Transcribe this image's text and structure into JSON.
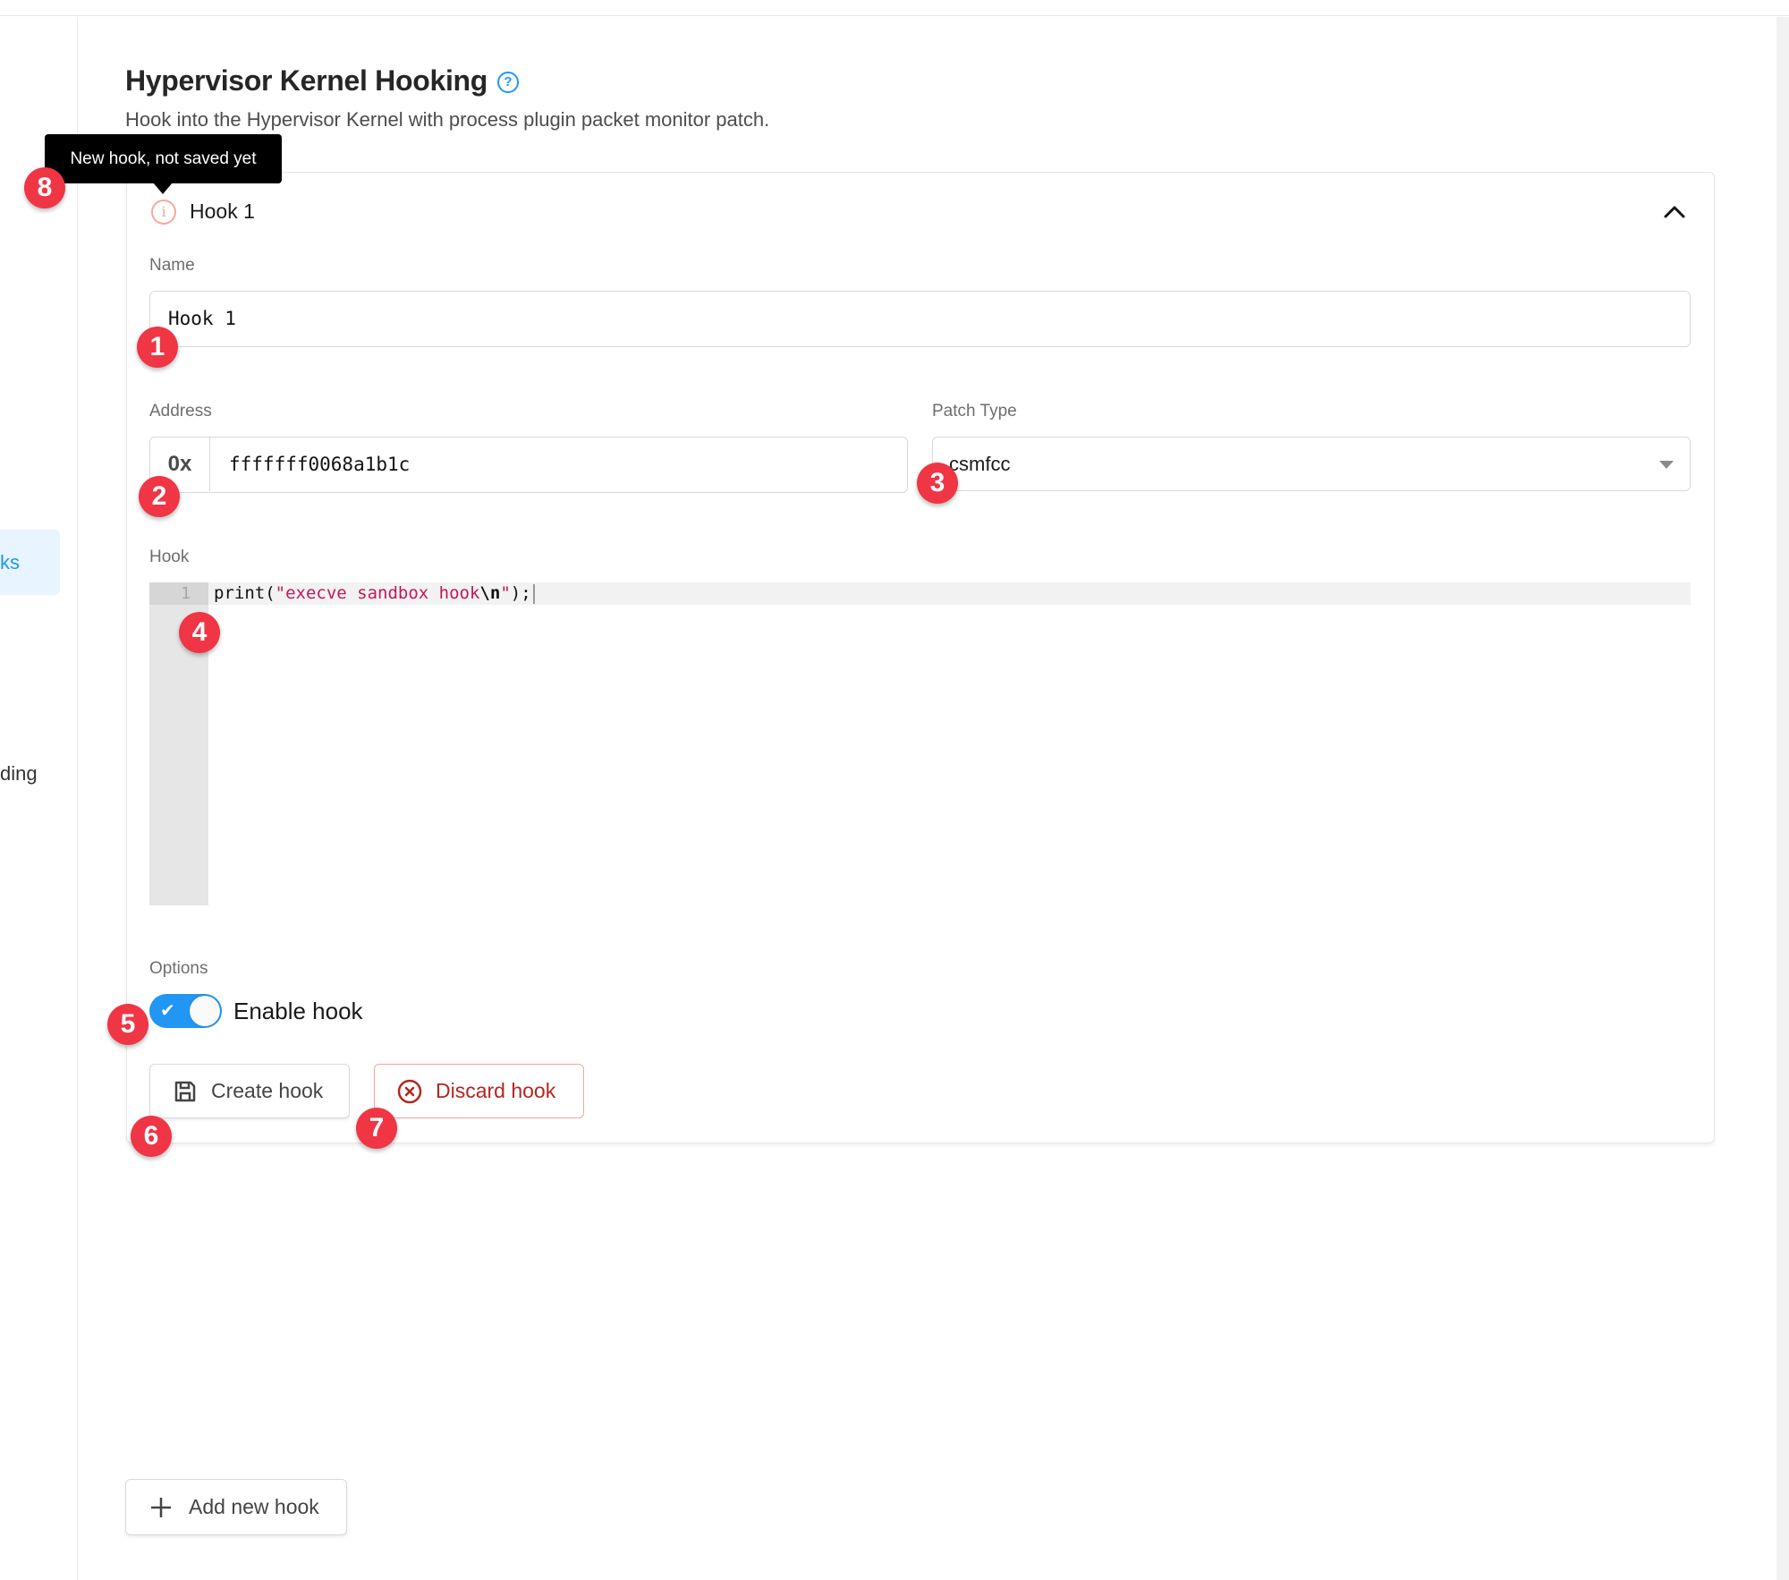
{
  "sidebar": {
    "active_item_partial": "ks",
    "item_partial": "ding",
    "active_color": "#2196f3"
  },
  "header": {
    "title": "Hypervisor Kernel Hooking",
    "help_icon": "question-circle-icon",
    "description": "Hook into the Hypervisor Kernel with process plugin packet monitor patch."
  },
  "tooltip": {
    "text": "New hook, not saved yet"
  },
  "hook": {
    "title": "Hook 1",
    "status_icon": "info-circle-icon",
    "status_color": "#f5a89b",
    "collapse_icon": "chevron-up-icon",
    "name_label": "Name",
    "name_value": "Hook 1",
    "address_label": "Address",
    "address_prefix": "0x",
    "address_value": "fffffff0068a1b1c",
    "patch_type_label": "Patch Type",
    "patch_type_value": "csmfcc",
    "code_label": "Hook",
    "code": {
      "line_number": "1",
      "tokens": {
        "fn": "print(",
        "str_open": "\"execve sandbox hook",
        "escape": "\\n",
        "str_close": "\"",
        "tail": ");"
      },
      "string_color": "#c2185b"
    },
    "options_label": "Options",
    "enable_toggle": {
      "label": "Enable hook",
      "checked": true,
      "color": "#2196f3"
    },
    "create_button": {
      "label": "Create hook",
      "icon": "save-icon"
    },
    "discard_button": {
      "label": "Discard hook",
      "icon": "x-circle-icon",
      "color": "#b3261e"
    }
  },
  "add_button": {
    "label": "Add new hook",
    "icon": "plus-icon"
  },
  "annotations": [
    "1",
    "2",
    "3",
    "4",
    "5",
    "6",
    "7",
    "8"
  ],
  "annotation_color": "#f03545"
}
